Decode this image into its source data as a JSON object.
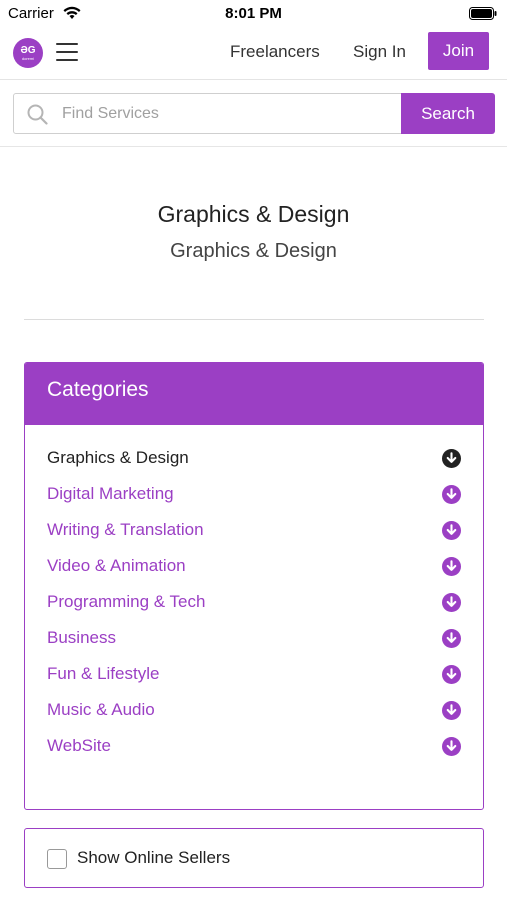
{
  "status_bar": {
    "carrier": "Carrier",
    "time": "8:01 PM"
  },
  "header": {
    "logo_mark": "ƏG",
    "logo_sub": "doremi",
    "links": {
      "freelancers": "Freelancers",
      "sign_in": "Sign In"
    },
    "join_label": "Join"
  },
  "search": {
    "placeholder": "Find Services",
    "button_label": "Search"
  },
  "page": {
    "title": "Graphics & Design",
    "subtitle": "Graphics & Design"
  },
  "categories": {
    "heading": "Categories",
    "items": [
      {
        "label": "Graphics & Design",
        "active": true
      },
      {
        "label": "Digital Marketing",
        "active": false
      },
      {
        "label": "Writing & Translation",
        "active": false
      },
      {
        "label": "Video & Animation",
        "active": false
      },
      {
        "label": "Programming & Tech",
        "active": false
      },
      {
        "label": "Business",
        "active": false
      },
      {
        "label": "Fun & Lifestyle",
        "active": false
      },
      {
        "label": "Music & Audio",
        "active": false
      },
      {
        "label": "WebSite",
        "active": false
      }
    ],
    "icon": "arrow-circle-down-icon"
  },
  "online_sellers": {
    "label": "Show Online Sellers",
    "checked": false
  },
  "colors": {
    "accent": "#9b3fc4",
    "active_text": "#222222"
  }
}
